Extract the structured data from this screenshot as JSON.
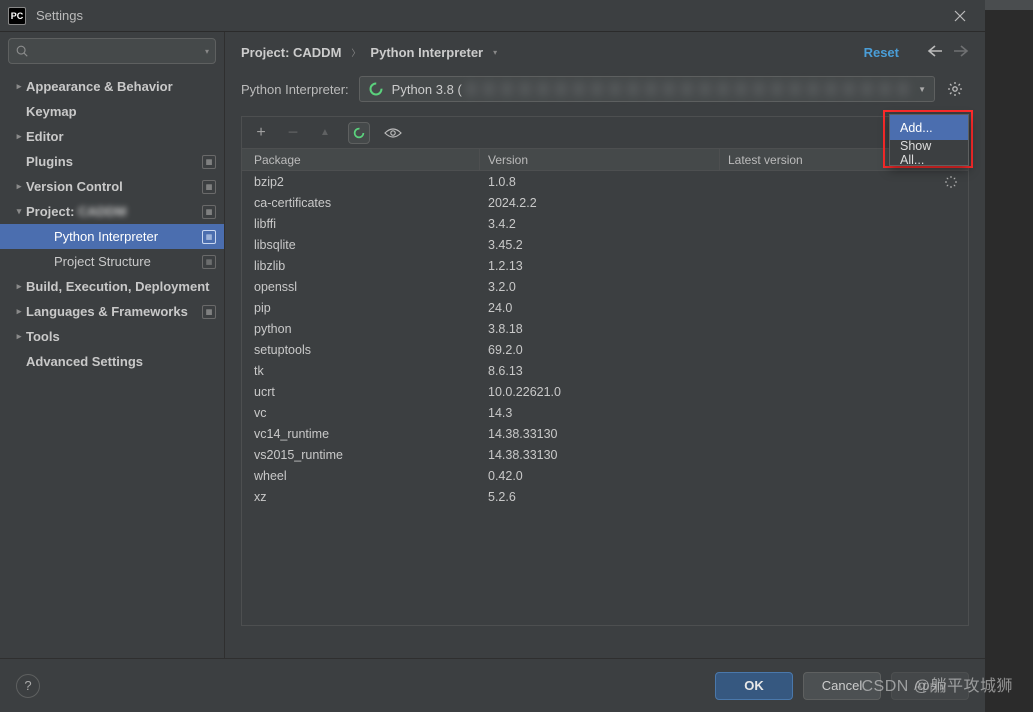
{
  "window": {
    "title": "Settings",
    "app_icon_text": "PC"
  },
  "search": {
    "placeholder": ""
  },
  "sidebar": {
    "items": [
      {
        "label": "Appearance & Behavior",
        "expandable": true,
        "bold": true
      },
      {
        "label": "Keymap",
        "expandable": false,
        "bold": true
      },
      {
        "label": "Editor",
        "expandable": true,
        "bold": true
      },
      {
        "label": "Plugins",
        "expandable": false,
        "bold": true,
        "badge": true
      },
      {
        "label": "Version Control",
        "expandable": true,
        "bold": true,
        "badge": true
      },
      {
        "label_prefix": "Project:",
        "label_blur": "CADDM",
        "expandable": true,
        "expanded": true,
        "bold": true,
        "badge": true
      },
      {
        "label": "Python Interpreter",
        "child": true,
        "selected": true,
        "badge": true
      },
      {
        "label": "Project Structure",
        "child": true,
        "badge": true
      },
      {
        "label": "Build, Execution, Deployment",
        "expandable": true,
        "bold": true
      },
      {
        "label": "Languages & Frameworks",
        "expandable": true,
        "bold": true,
        "badge": true
      },
      {
        "label": "Tools",
        "expandable": true,
        "bold": true
      },
      {
        "label": "Advanced Settings",
        "expandable": false,
        "bold": true
      }
    ]
  },
  "breadcrumb": {
    "parts": [
      "Project: CADDM",
      "Python Interpreter"
    ],
    "reset": "Reset"
  },
  "interpreter": {
    "label": "Python Interpreter:",
    "value": "Python 3.8 ("
  },
  "dropdown": {
    "items": [
      "Add...",
      "Show All..."
    ]
  },
  "table": {
    "headers": {
      "package": "Package",
      "version": "Version",
      "latest": "Latest version"
    },
    "rows": [
      {
        "pkg": "bzip2",
        "ver": "1.0.8"
      },
      {
        "pkg": "ca-certificates",
        "ver": "2024.2.2"
      },
      {
        "pkg": "libffi",
        "ver": "3.4.2"
      },
      {
        "pkg": "libsqlite",
        "ver": "3.45.2"
      },
      {
        "pkg": "libzlib",
        "ver": "1.2.13"
      },
      {
        "pkg": "openssl",
        "ver": "3.2.0"
      },
      {
        "pkg": "pip",
        "ver": "24.0"
      },
      {
        "pkg": "python",
        "ver": "3.8.18"
      },
      {
        "pkg": "setuptools",
        "ver": "69.2.0"
      },
      {
        "pkg": "tk",
        "ver": "8.6.13"
      },
      {
        "pkg": "ucrt",
        "ver": "10.0.22621.0"
      },
      {
        "pkg": "vc",
        "ver": "14.3"
      },
      {
        "pkg": "vc14_runtime",
        "ver": "14.38.33130"
      },
      {
        "pkg": "vs2015_runtime",
        "ver": "14.38.33130"
      },
      {
        "pkg": "wheel",
        "ver": "0.42.0"
      },
      {
        "pkg": "xz",
        "ver": "5.2.6"
      }
    ]
  },
  "footer": {
    "ok": "OK",
    "cancel": "Cancel",
    "apply": "Apply"
  },
  "watermark": "CSDN @躺平攻城狮"
}
